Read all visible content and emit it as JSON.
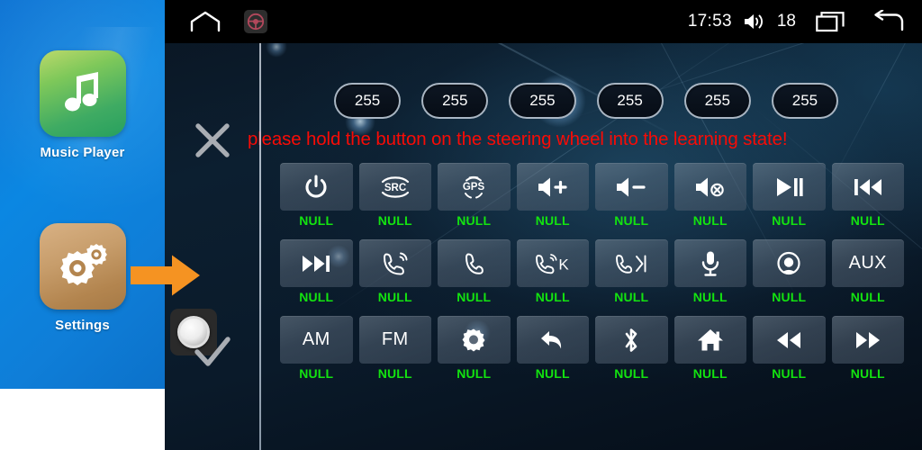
{
  "sidebar": {
    "apps": [
      {
        "label": "Music Player",
        "icon": "music-note-icon"
      },
      {
        "label": "Settings",
        "icon": "gears-icon"
      }
    ]
  },
  "statusbar": {
    "home_icon": "home-icon",
    "steering_wheel_icon": "steering-wheel-icon",
    "time": "17:53",
    "volume_icon": "volume-icon",
    "volume_level": "18",
    "recents_icon": "recent-apps-icon",
    "back_icon": "back-arrow-icon"
  },
  "controls": {
    "cancel_icon": "x-close-icon",
    "confirm_icon": "checkmark-icon",
    "knob_icon": "rotary-knob-icon",
    "pointer_icon": "orange-arrow-icon"
  },
  "values": {
    "pills": [
      "255",
      "255",
      "255",
      "255",
      "255",
      "255"
    ]
  },
  "message": {
    "warning_text": "please hold the button on the steering wheel into the learning state!",
    "warning_color": "#f90b06"
  },
  "grid": {
    "null_label": "NULL",
    "rows": [
      [
        {
          "icon": "power-icon",
          "text": "",
          "status": "NULL"
        },
        {
          "icon": "src-icon",
          "text": "",
          "status": "NULL"
        },
        {
          "icon": "gps-icon",
          "text": "",
          "status": "NULL"
        },
        {
          "icon": "volume-up-icon",
          "text": "",
          "status": "NULL"
        },
        {
          "icon": "volume-down-icon",
          "text": "",
          "status": "NULL"
        },
        {
          "icon": "mute-icon",
          "text": "",
          "status": "NULL"
        },
        {
          "icon": "play-pause-icon",
          "text": "",
          "status": "NULL"
        },
        {
          "icon": "previous-track-icon",
          "text": "",
          "status": "NULL"
        }
      ],
      [
        {
          "icon": "next-track-icon",
          "text": "",
          "status": "NULL"
        },
        {
          "icon": "answer-call-icon",
          "text": "",
          "status": "NULL"
        },
        {
          "icon": "hangup-call-icon",
          "text": "",
          "status": "NULL"
        },
        {
          "icon": "answer-call-k-icon",
          "text": "",
          "status": "NULL"
        },
        {
          "icon": "hangup-call-next-icon",
          "text": "",
          "status": "NULL"
        },
        {
          "icon": "microphone-icon",
          "text": "",
          "status": "NULL"
        },
        {
          "icon": "camera-icon",
          "text": "",
          "status": "NULL"
        },
        {
          "icon": "",
          "text": "AUX",
          "status": "NULL"
        }
      ],
      [
        {
          "icon": "",
          "text": "AM",
          "status": "NULL"
        },
        {
          "icon": "",
          "text": "FM",
          "status": "NULL"
        },
        {
          "icon": "settings-gear-icon",
          "text": "",
          "status": "NULL"
        },
        {
          "icon": "back-arrow-icon",
          "text": "",
          "status": "NULL"
        },
        {
          "icon": "bluetooth-icon",
          "text": "",
          "status": "NULL"
        },
        {
          "icon": "home-icon",
          "text": "",
          "status": "NULL"
        },
        {
          "icon": "rewind-icon",
          "text": "",
          "status": "NULL"
        },
        {
          "icon": "fast-forward-icon",
          "text": "",
          "status": "NULL"
        }
      ]
    ]
  },
  "colors": {
    "sidebar_blue": "#0b87e2",
    "panel_dark": "#0a1a2a",
    "status_green": "#13e310",
    "warning_red": "#f90b06",
    "accent_orange": "#f59322"
  }
}
